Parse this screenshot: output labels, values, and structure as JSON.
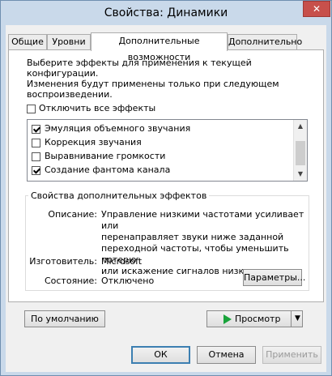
{
  "window": {
    "title": "Свойства: Динамики",
    "close_symbol": "✕"
  },
  "tabs": [
    {
      "label": "Общие"
    },
    {
      "label": "Уровни"
    },
    {
      "label": "Дополнительные возможности",
      "active": true
    },
    {
      "label": "Дополнительно"
    }
  ],
  "description": {
    "line1": "Выберите эффекты для применения к текущей конфигурации.",
    "line2": "Изменения будут применены только при следующем",
    "line3": "воспроизведении."
  },
  "disable_all": {
    "label": "Отключить все эффекты",
    "checked": false
  },
  "effects": [
    {
      "label": "Эмуляция объемного звучания",
      "checked": true
    },
    {
      "label": "Коррекция звучания",
      "checked": false
    },
    {
      "label": "Выравнивание громкости",
      "checked": false
    },
    {
      "label": "Создание фантома канала",
      "checked": true
    }
  ],
  "properties": {
    "group_title": "Свойства дополнительных эффектов",
    "description_label": "Описание:",
    "description_lines": [
      "Управление низкими частотами усиливает или",
      "перенаправляет звуки ниже заданной",
      "переходной частоты, чтобы уменьшить потерю",
      "или искажение сигналов низких частот."
    ],
    "vendor_label": "Изготовитель:",
    "vendor_value": "Microsoft",
    "state_label": "Состояние:",
    "state_value": "Отключено",
    "params_button": "Параметры..."
  },
  "buttons": {
    "default": "По умолчанию",
    "preview": "Просмотр",
    "preview_arrow": "▼",
    "ok": "ОК",
    "cancel": "Отмена",
    "apply": "Применить"
  },
  "scroll": {
    "up": "▲",
    "down": "▼"
  }
}
